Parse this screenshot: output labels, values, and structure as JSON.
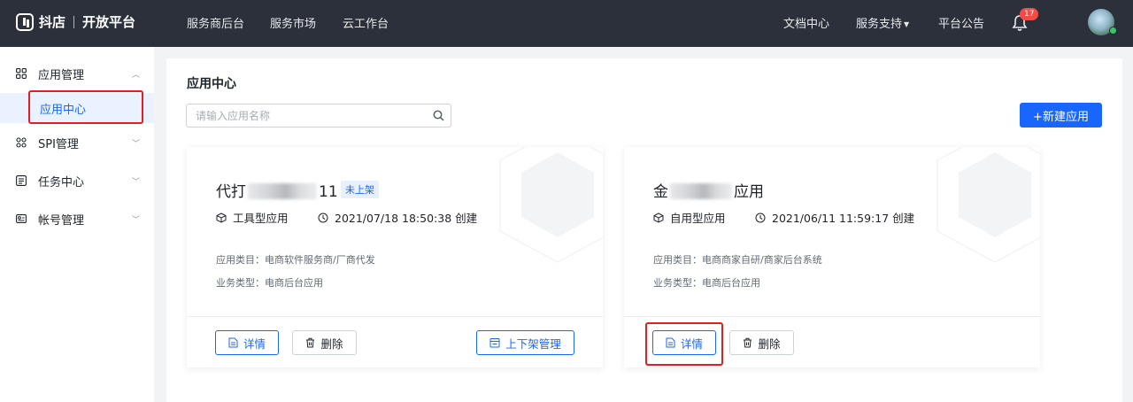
{
  "header": {
    "logo_text": "抖店",
    "platform": "开放平台",
    "nav": [
      "服务商后台",
      "服务市场",
      "云工作台"
    ],
    "right_nav": [
      "文档中心",
      "服务支持",
      "平台公告"
    ],
    "notification_count": "17"
  },
  "sidebar": {
    "items": [
      {
        "label": "应用管理",
        "icon": "grid-icon",
        "expanded": true
      },
      {
        "label": "应用中心",
        "active": true
      },
      {
        "label": "SPI管理",
        "icon": "spi-icon"
      },
      {
        "label": "任务中心",
        "icon": "task-icon"
      },
      {
        "label": "帐号管理",
        "icon": "account-icon"
      }
    ]
  },
  "main": {
    "title": "应用中心",
    "search_placeholder": "请输入应用名称",
    "new_button": "+新建应用",
    "cards": [
      {
        "title_start": "代打",
        "title_end": "11",
        "tag": "未上架",
        "type": "工具型应用",
        "created": "2021/07/18 18:50:38 创建",
        "category": "应用类目：电商软件服务商/厂商代发",
        "business": "业务类型：电商后台应用",
        "buttons": [
          "详情",
          "删除",
          "上下架管理"
        ]
      },
      {
        "title_start": "金",
        "title_end": "应用",
        "type": "自用型应用",
        "created": "2021/06/11 11:59:17 创建",
        "category": "应用类目：电商商家自研/商家后台系统",
        "business": "业务类型：电商后台应用",
        "buttons": [
          "详情",
          "删除"
        ]
      }
    ]
  },
  "colors": {
    "accent": "#1966ff",
    "topbar": "#2b303b",
    "highlight_box": "#e02020"
  }
}
